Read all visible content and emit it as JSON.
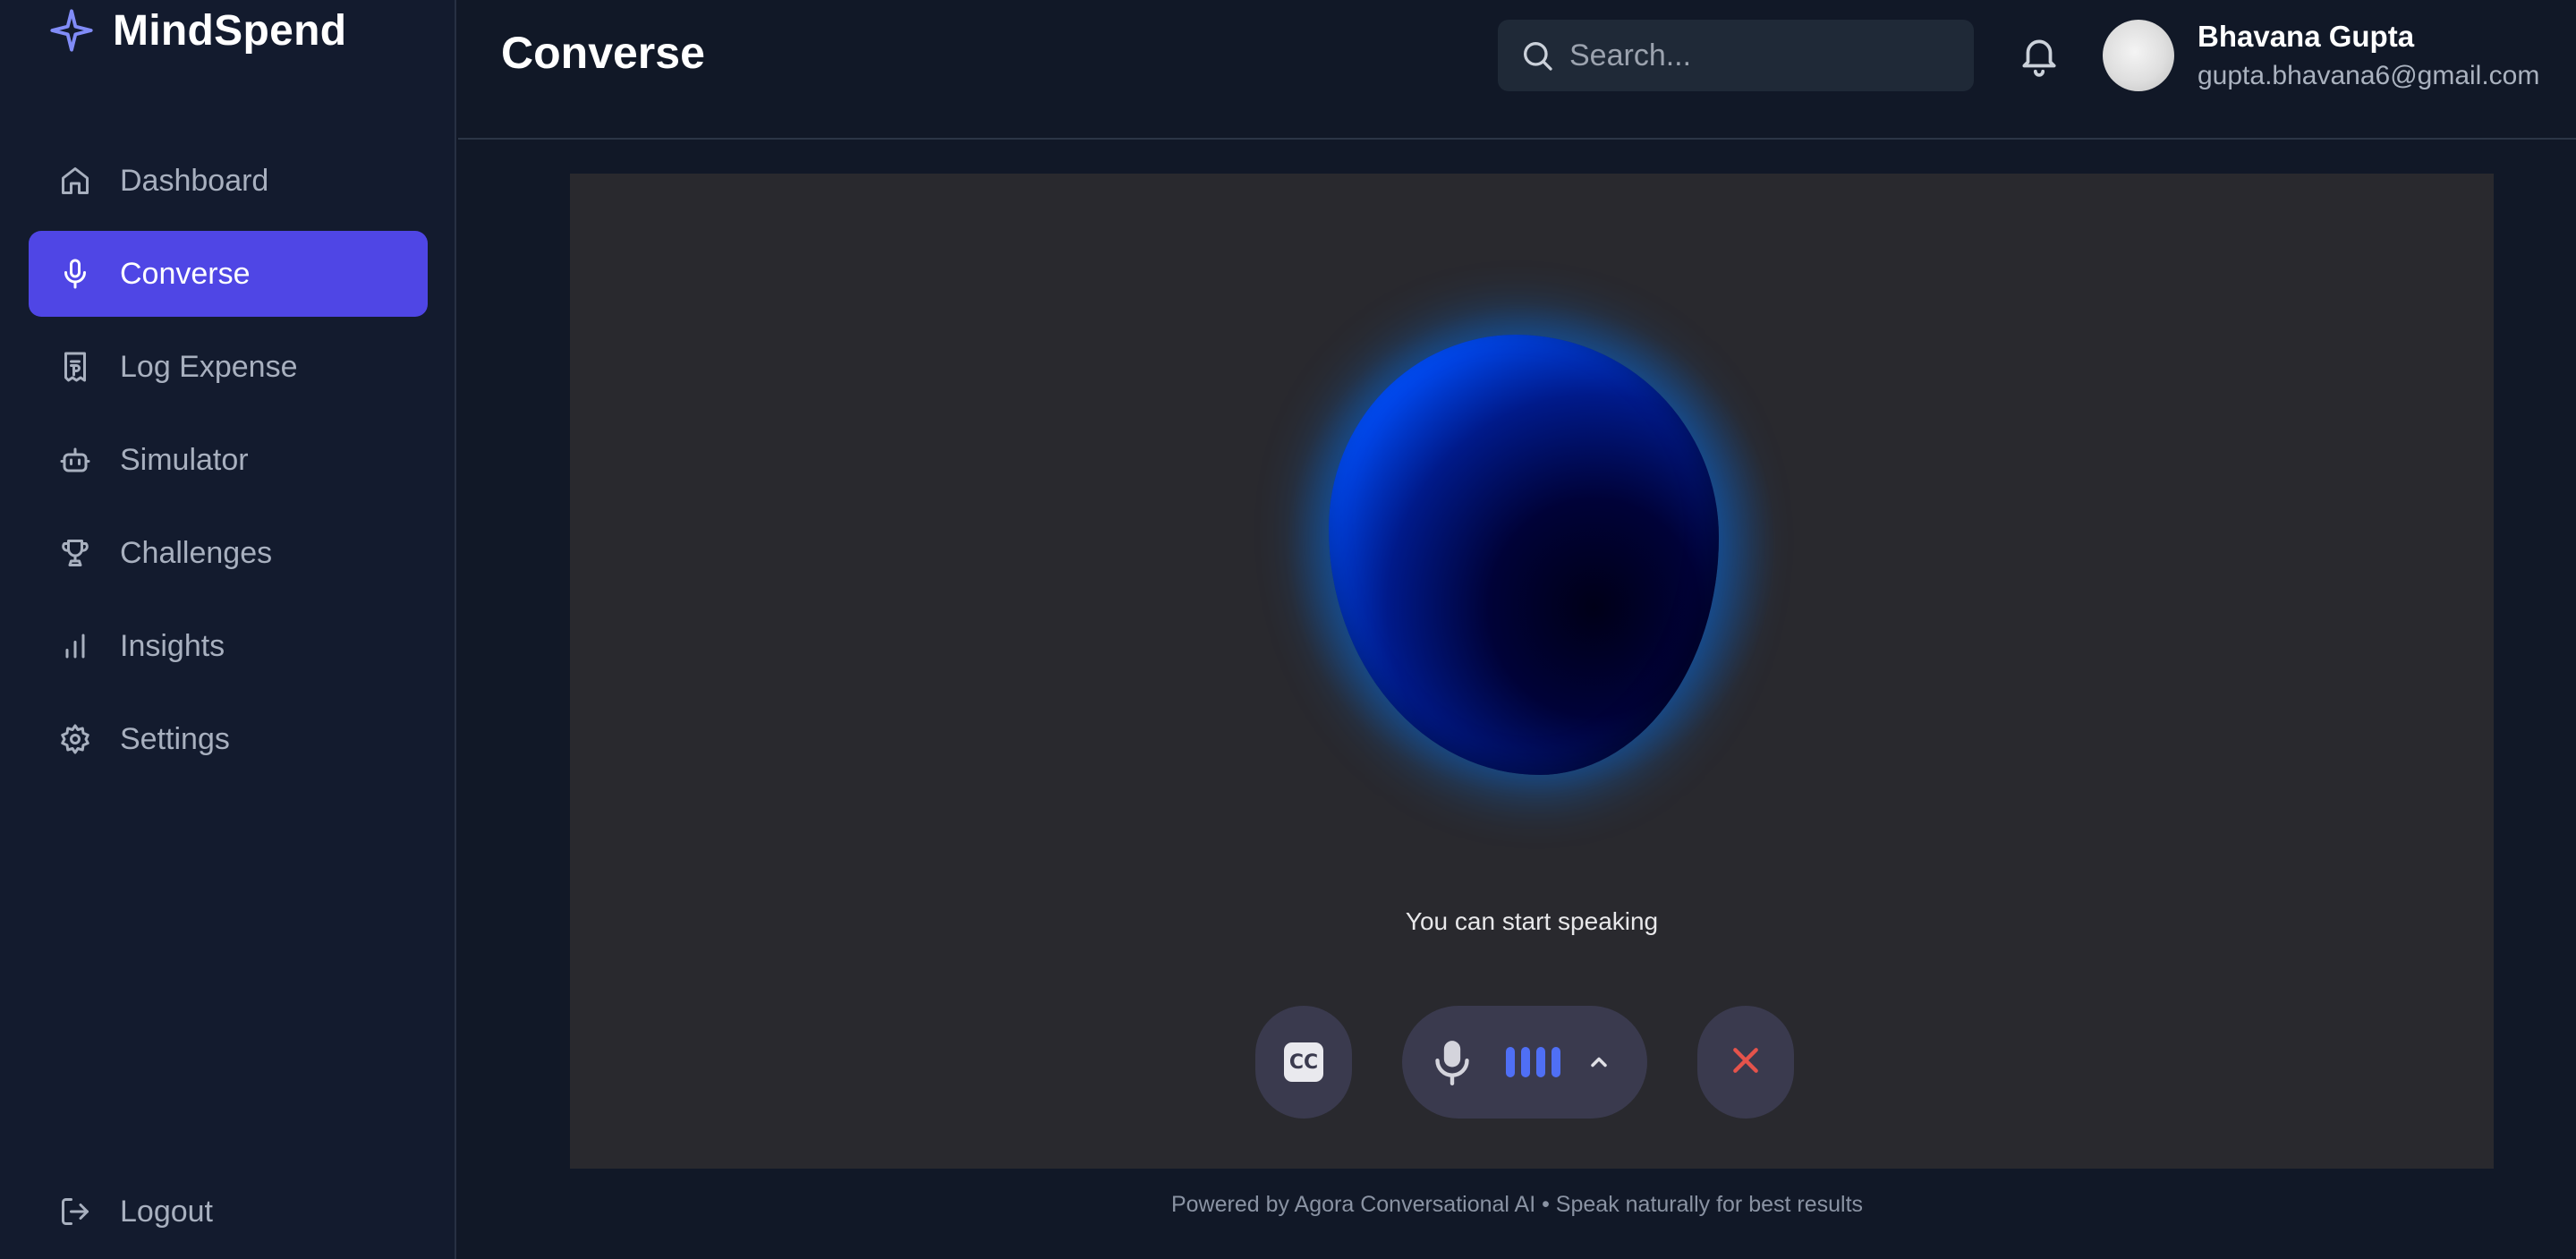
{
  "app": {
    "name": "MindSpend",
    "brand_color": "#818cf8"
  },
  "sidebar": {
    "items": [
      {
        "label": "Dashboard",
        "icon": "home-icon",
        "active": false
      },
      {
        "label": "Converse",
        "icon": "microphone-icon",
        "active": true
      },
      {
        "label": "Log Expense",
        "icon": "receipt-icon",
        "active": false
      },
      {
        "label": "Simulator",
        "icon": "bot-icon",
        "active": false
      },
      {
        "label": "Challenges",
        "icon": "trophy-icon",
        "active": false
      },
      {
        "label": "Insights",
        "icon": "bar-chart-icon",
        "active": false
      },
      {
        "label": "Settings",
        "icon": "gear-icon",
        "active": false
      }
    ],
    "logout_label": "Logout",
    "active_color": "#4f46e5"
  },
  "header": {
    "title": "Converse",
    "search_placeholder": "Search...",
    "user": {
      "name": "Bhavana Gupta",
      "email": "gupta.bhavana6@gmail.com"
    }
  },
  "stage": {
    "status_text": "You can start speaking",
    "controls": {
      "captions_label": "CC",
      "end_color": "#e5534b",
      "level_color": "#4f6ff5"
    }
  },
  "footer": {
    "note": "Powered by Agora Conversational AI • Speak naturally for best results"
  }
}
